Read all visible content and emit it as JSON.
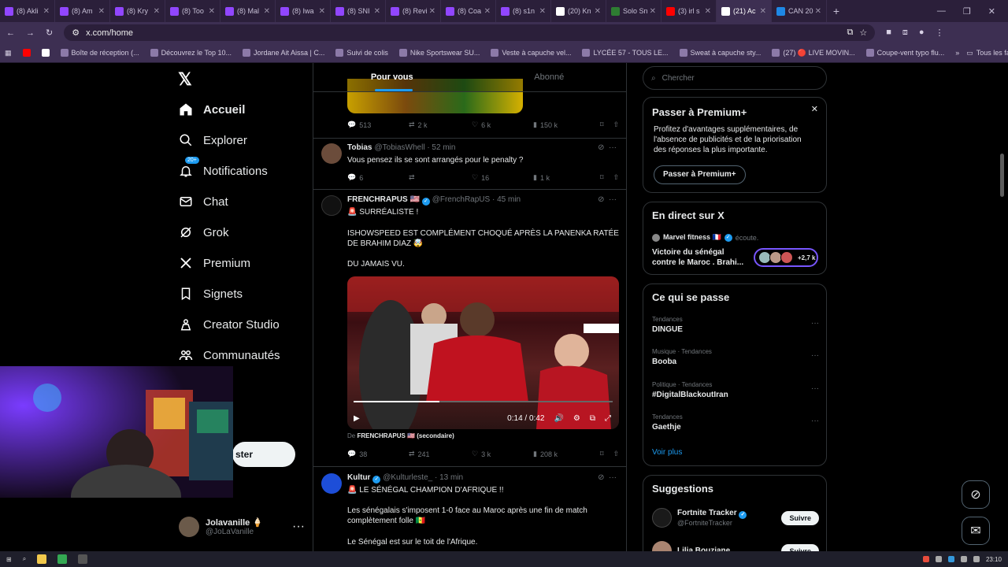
{
  "browser": {
    "tabs": [
      {
        "label": "(8) Akli",
        "color": "#9146ff"
      },
      {
        "label": "(8) Am",
        "color": "#9146ff"
      },
      {
        "label": "(8) Kry",
        "color": "#9146ff"
      },
      {
        "label": "(8) Too",
        "color": "#9146ff"
      },
      {
        "label": "(8) Mal",
        "color": "#9146ff"
      },
      {
        "label": "(8) Iwa",
        "color": "#9146ff"
      },
      {
        "label": "(8) SNI",
        "color": "#9146ff"
      },
      {
        "label": "(8) Revi",
        "color": "#9146ff"
      },
      {
        "label": "(8) Coa",
        "color": "#9146ff"
      },
      {
        "label": "(8) s1n",
        "color": "#9146ff"
      },
      {
        "label": "(20) Kn",
        "color": "#ffffff"
      },
      {
        "label": "Solo Sn",
        "color": "#2e7d32"
      },
      {
        "label": "(3) irl s",
        "color": "#ff0000"
      },
      {
        "label": "(21) Ac",
        "color": "#ffffff"
      },
      {
        "label": "CAN 20",
        "color": "#1e88e5"
      }
    ],
    "new_tab": "+",
    "url": "x.com/home",
    "bookmarks": [
      "Boîte de réception (...",
      "Découvrez le Top 10...",
      "Jordane Ait Aissa | C...",
      "Suivi de colis",
      "Nike Sportswear SU...",
      "Veste à capuche vel...",
      "LYCÉE 57 - TOUS LE...",
      "Sweat à capuche sty...",
      "(27) 🔴 LIVE MOVIN...",
      "Coupe-vent typo flu..."
    ],
    "all_bookmarks": "Tous les favoris"
  },
  "nav": {
    "items": [
      {
        "label": "Accueil"
      },
      {
        "label": "Explorer"
      },
      {
        "label": "Notifications",
        "badge": "20+"
      },
      {
        "label": "Chat"
      },
      {
        "label": "Grok"
      },
      {
        "label": "Premium"
      },
      {
        "label": "Signets"
      },
      {
        "label": "Creator Studio"
      },
      {
        "label": "Communautés"
      }
    ],
    "post_button": "ster",
    "account": {
      "name": "Jolavanille 🍦",
      "handle": "@JoLaVanille"
    }
  },
  "feed": {
    "tabs": [
      "Pour vous",
      "Abonné"
    ],
    "t0": {
      "replies": "513",
      "reposts": "2 k",
      "likes": "6 k",
      "views": "150 k"
    },
    "t1": {
      "name": "Tobias",
      "handle": "@TobiasWhell",
      "time": "· 52 min",
      "text": "Vous pensez ils se sont arrangés pour le penalty ?",
      "replies": "6",
      "reposts": "",
      "likes": "16",
      "views": "1 k"
    },
    "t2": {
      "name": "FRENCHRAPUS 🇺🇸",
      "handle": "@FrenchRapUS",
      "time": "· 45 min",
      "line1": "🚨 SURRÉALISTE !",
      "line2": "ISHOWSPEED EST COMPLÉMENT CHOQUÉ APRÈS LA PANENKA RATÉE DE BRAHIM DIAZ 🤯",
      "line3": "DU JAMAIS VU.",
      "video_time": "0:14 / 0:42",
      "video_progress": 0.33,
      "via_prefix": "De",
      "via": "FRENCHRAPUS 🇺🇸 (secondaire)",
      "replies": "38",
      "reposts": "241",
      "likes": "3 k",
      "views": "208 k"
    },
    "t3": {
      "name": "Kultur",
      "handle": "@Kulturleste_",
      "time": "· 13 min",
      "line1": "🚨 LE SÉNÉGAL CHAMPION D'AFRIQUE !!",
      "line2": "Les sénégalais s'imposent 1-0 face au Maroc après une fin de match complètement folle 🇸🇳",
      "line3": "Le Sénégal est sur le toit de l'Afrique."
    }
  },
  "sidebar": {
    "search_placeholder": "Chercher",
    "premium": {
      "title": "Passer à Premium+",
      "text": "Profitez d'avantages supplémentaires, de l'absence de publicités et de la priorisation des réponses la plus importante.",
      "button": "Passer à Premium+"
    },
    "live": {
      "title": "En direct sur X",
      "host": "Marvel fitness 🇫🇷",
      "host_action": "écoute.",
      "event": "Victoire du sénégal contre le Maroc . Brahi...",
      "listeners": "+2,7 k"
    },
    "trends": {
      "title": "Ce qui se passe",
      "items": [
        {
          "cat": "Tendances",
          "name": "DINGUE"
        },
        {
          "cat": "Musique · Tendances",
          "name": "Booba"
        },
        {
          "cat": "Politique · Tendances",
          "name": "#DigitalBlackoutIran"
        },
        {
          "cat": "Tendances",
          "name": "Gaethje"
        }
      ],
      "more": "Voir plus"
    },
    "suggestions": {
      "title": "Suggestions",
      "items": [
        {
          "name": "Fortnite Tracker",
          "handle": "@FortniteTracker",
          "follow": "Suivre"
        },
        {
          "name": "Lilia Bouziane",
          "handle": "",
          "follow": "Suivre"
        }
      ]
    }
  },
  "taskbar": {
    "clock": "23:10"
  }
}
